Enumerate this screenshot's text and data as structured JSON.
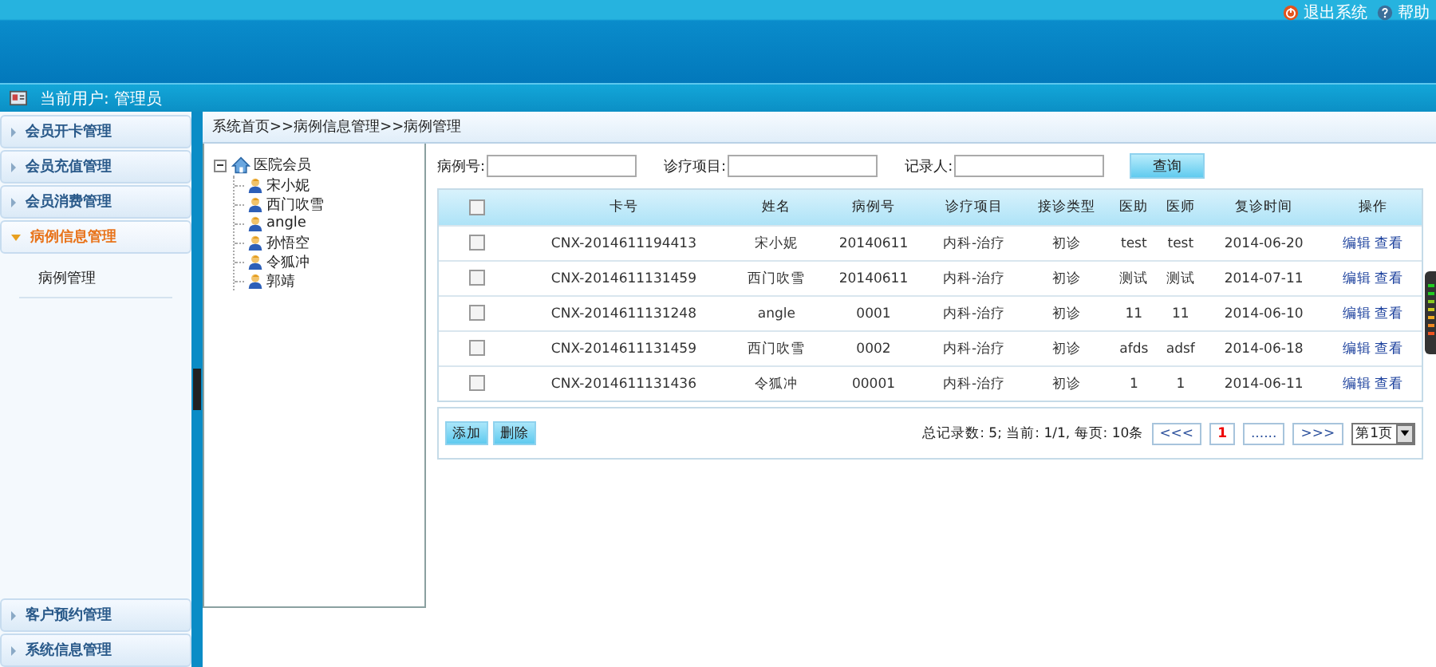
{
  "header": {
    "links": [
      {
        "label": "退出系统",
        "kind": "exit"
      },
      {
        "label": "帮助",
        "kind": "help"
      }
    ]
  },
  "user_bar": {
    "label": "当前用户: 管理员"
  },
  "sidebar": {
    "items": [
      {
        "label": "会员开卡管理",
        "expanded": false
      },
      {
        "label": "会员充值管理",
        "expanded": false
      },
      {
        "label": "会员消费管理",
        "expanded": false
      },
      {
        "label": "病例信息管理",
        "expanded": true,
        "children": [
          {
            "label": "病例管理"
          }
        ]
      }
    ],
    "bottom_items": [
      {
        "label": "客户预约管理",
        "expanded": false
      },
      {
        "label": "系统信息管理",
        "expanded": false
      }
    ]
  },
  "breadcrumb": "系统首页>>病例信息管理>>病例管理",
  "tree": {
    "label": "医院会员",
    "expanded": true,
    "children": [
      {
        "label": "宋小妮"
      },
      {
        "label": "西门吹雪"
      },
      {
        "label": "angle"
      },
      {
        "label": "孙悟空"
      },
      {
        "label": "令狐冲"
      },
      {
        "label": "郭靖"
      }
    ]
  },
  "search": {
    "fields": [
      {
        "label": "病例号:"
      },
      {
        "label": "诊疗项目:"
      },
      {
        "label": "记录人:"
      }
    ],
    "button": "查询"
  },
  "table": {
    "all_checked": false,
    "columns": [
      "卡号",
      "姓名",
      "病例号",
      "诊疗项目",
      "接诊类型",
      "医助",
      "医师",
      "复诊时间",
      "操作"
    ],
    "rows": [
      {
        "checked": false,
        "cells": [
          "CNX-2014611194413",
          "宋小妮",
          "20140611",
          "内科-治疗",
          "初诊",
          "test",
          "test",
          "2014-06-20"
        ],
        "actions": [
          "编辑",
          "查看"
        ]
      },
      {
        "checked": false,
        "cells": [
          "CNX-2014611131459",
          "西门吹雪",
          "20140611",
          "内科-治疗",
          "初诊",
          "测试",
          "测试",
          "2014-07-11"
        ],
        "actions": [
          "编辑",
          "查看"
        ]
      },
      {
        "checked": false,
        "cells": [
          "CNX-2014611131248",
          "angle",
          "0001",
          "内科-治疗",
          "初诊",
          "11",
          "11",
          "2014-06-10"
        ],
        "actions": [
          "编辑",
          "查看"
        ]
      },
      {
        "checked": false,
        "cells": [
          "CNX-2014611131459",
          "西门吹雪",
          "0002",
          "内科-治疗",
          "初诊",
          "afds",
          "adsf",
          "2014-06-18"
        ],
        "actions": [
          "编辑",
          "查看"
        ]
      },
      {
        "checked": false,
        "cells": [
          "CNX-2014611131436",
          "令狐冲",
          "00001",
          "内科-治疗",
          "初诊",
          "1",
          "1",
          "2014-06-11"
        ],
        "actions": [
          "编辑",
          "查看"
        ]
      }
    ]
  },
  "footer": {
    "buttons": [
      "添加",
      "删除"
    ],
    "summary": "总记录数: 5; 当前: 1/1, 每页: 10条",
    "pages": [
      {
        "label": "<<<",
        "selected": false
      },
      {
        "label": "1",
        "selected": true
      },
      {
        "label": "......",
        "selected": false
      },
      {
        "label": ">>>",
        "selected": false
      }
    ],
    "page_select": "第1页"
  }
}
